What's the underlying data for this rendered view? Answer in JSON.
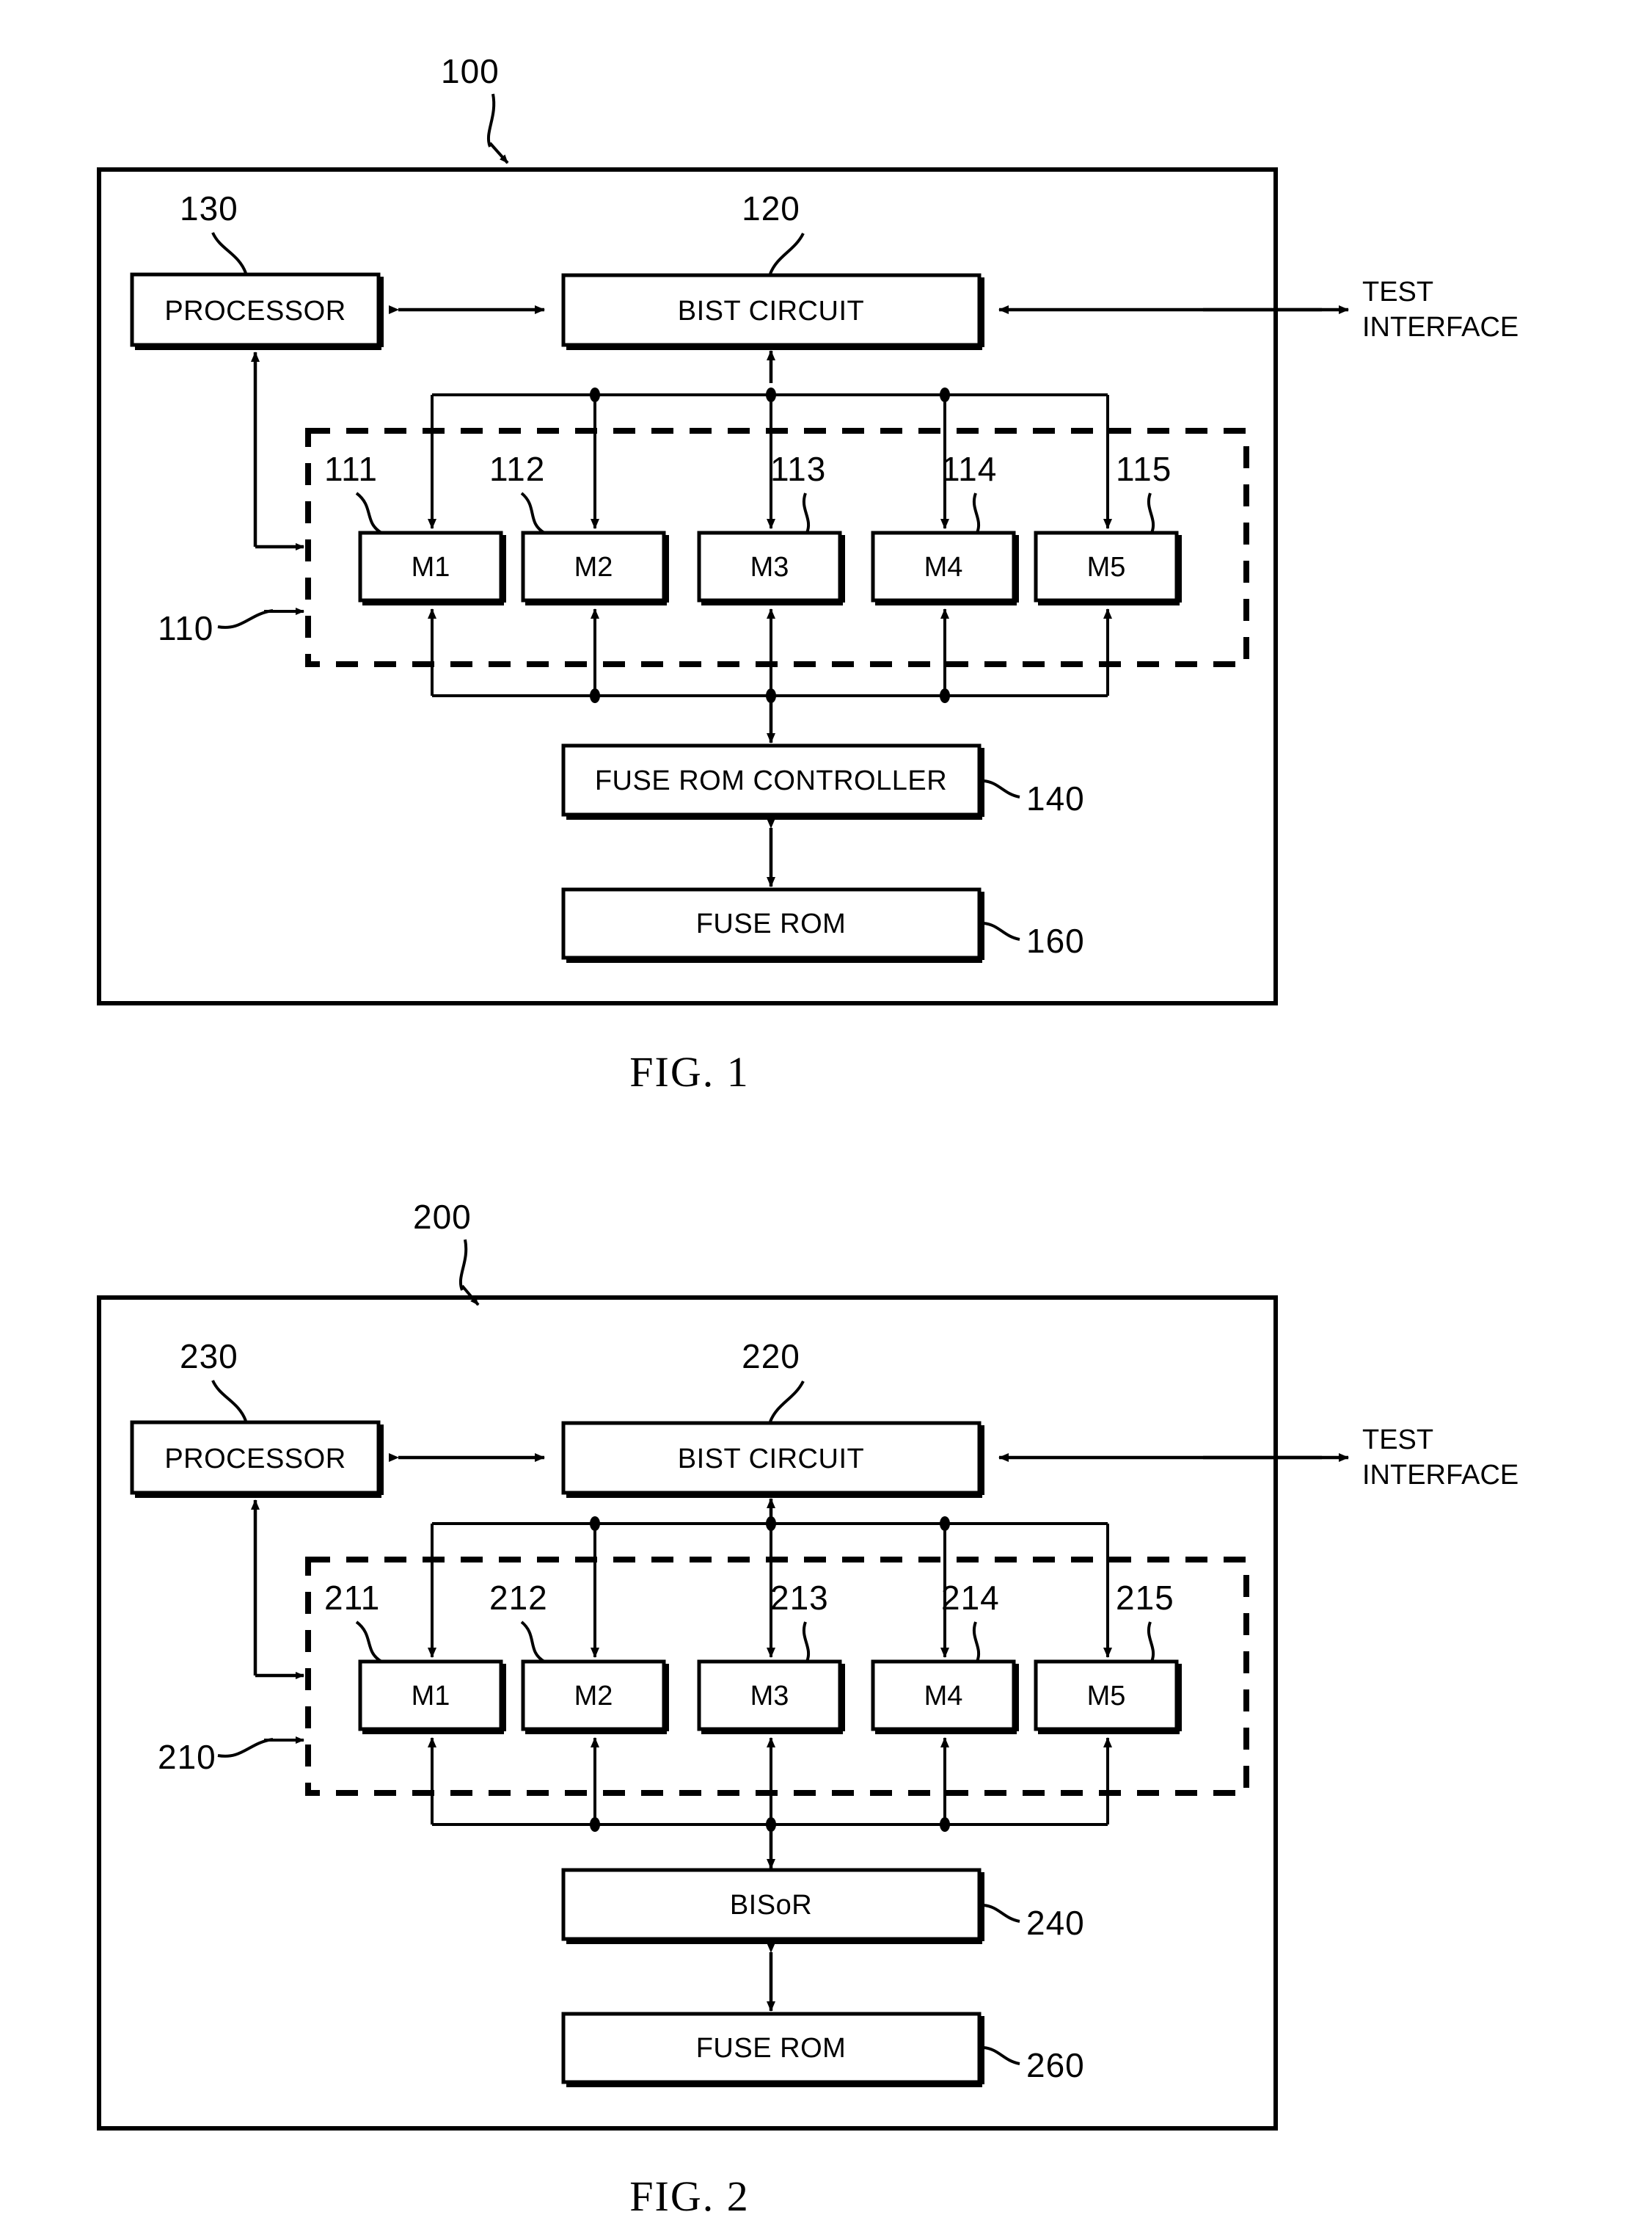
{
  "document": {
    "type": "patent-drawing-sheet",
    "figure_count": 2
  },
  "figures": [
    {
      "id": "fig1",
      "caption": "FIG. 1",
      "system_ref": "100",
      "blocks": [
        {
          "name": "processor",
          "label": "PROCESSOR",
          "ref": "130"
        },
        {
          "name": "bist-circuit",
          "label": "BIST CIRCUIT",
          "ref": "120"
        },
        {
          "name": "repair-unit",
          "label": "FUSE ROM CONTROLLER",
          "ref": "140"
        },
        {
          "name": "fuse-rom",
          "label": "FUSE ROM",
          "ref": "160"
        }
      ],
      "memory_group": {
        "ref": "110",
        "memories": [
          {
            "label": "M1",
            "ref": "111"
          },
          {
            "label": "M2",
            "ref": "112"
          },
          {
            "label": "M3",
            "ref": "113"
          },
          {
            "label": "M4",
            "ref": "114"
          },
          {
            "label": "M5",
            "ref": "115"
          }
        ]
      },
      "external_port": {
        "line1": "TEST",
        "line2": "INTERFACE"
      }
    },
    {
      "id": "fig2",
      "caption": "FIG. 2",
      "system_ref": "200",
      "blocks": [
        {
          "name": "processor",
          "label": "PROCESSOR",
          "ref": "230"
        },
        {
          "name": "bist-circuit",
          "label": "BIST CIRCUIT",
          "ref": "220"
        },
        {
          "name": "repair-unit",
          "label": "BISoR",
          "ref": "240"
        },
        {
          "name": "fuse-rom",
          "label": "FUSE ROM",
          "ref": "260"
        }
      ],
      "memory_group": {
        "ref": "210",
        "memories": [
          {
            "label": "M1",
            "ref": "211"
          },
          {
            "label": "M2",
            "ref": "212"
          },
          {
            "label": "M3",
            "ref": "213"
          },
          {
            "label": "M4",
            "ref": "214"
          },
          {
            "label": "M5",
            "ref": "215"
          }
        ]
      },
      "external_port": {
        "line1": "TEST",
        "line2": "INTERFACE"
      }
    }
  ],
  "colors": {
    "ink": "#000000",
    "paper": "#ffffff"
  }
}
